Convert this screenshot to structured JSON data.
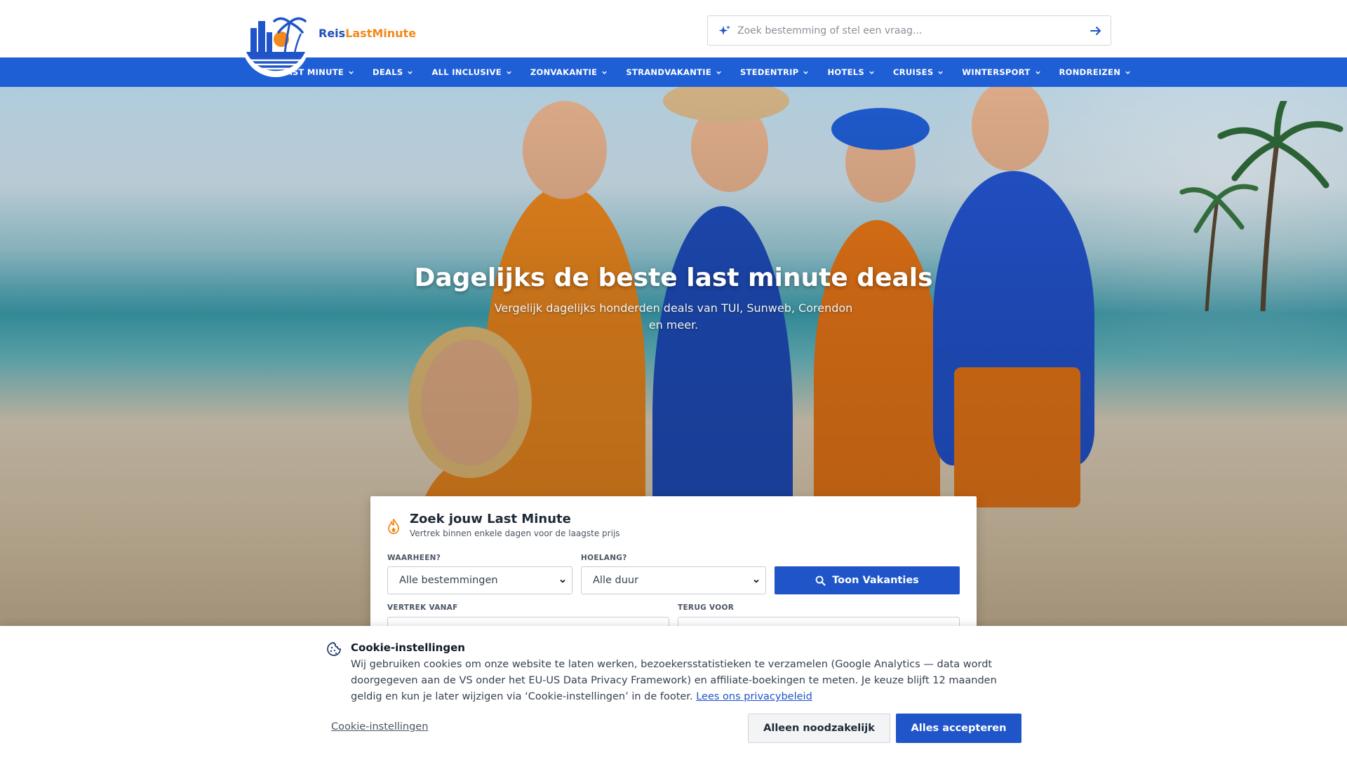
{
  "header": {
    "brand_part1": "Reis",
    "brand_part2": "LastMinute",
    "search_placeholder": "Zoek bestemming of stel een vraag..."
  },
  "nav": {
    "items": [
      {
        "label": "LAST MINUTE"
      },
      {
        "label": "DEALS"
      },
      {
        "label": "ALL INCLUSIVE"
      },
      {
        "label": "ZONVAKANTIE"
      },
      {
        "label": "STRANDVAKANTIE"
      },
      {
        "label": "STEDENTRIP"
      },
      {
        "label": "HOTELS"
      },
      {
        "label": "CRUISES"
      },
      {
        "label": "WINTERSPORT"
      },
      {
        "label": "RONDREIZEN"
      }
    ]
  },
  "hero": {
    "title": "Dagelijks de beste last minute deals",
    "subtitle": "Vergelijk dagelijks honderden deals van TUI, Sunweb, Corendon en meer."
  },
  "search_card": {
    "title": "Zoek jouw Last Minute",
    "subtitle": "Vertrek binnen enkele dagen voor de laagste prijs",
    "destination_label": "WAARHEEN?",
    "destination_value": "Alle bestemmingen",
    "duration_label": "HOELANG?",
    "duration_value": "Alle duur",
    "search_button": "Toon Vakanties",
    "departure_label": "VERTREK VANAF",
    "return_label": "TERUG VOOR"
  },
  "cookie": {
    "title": "Cookie-instellingen",
    "text": "Wij gebruiken cookies om onze website te laten werken, bezoekersstatistieken te verzamelen (Google Analytics — data wordt doorgegeven aan de VS onder het EU-US Data Privacy Framework) en affiliate-boekingen te meten. Je keuze blijft 12 maanden geldig en kun je later wijzigen via ‘Cookie-instellingen’ in de footer.",
    "privacy_link": "Lees ons privacybeleid",
    "settings_link": "Cookie-instellingen",
    "necessary_button": "Alleen noodzakelijk",
    "accept_button": "Alles accepteren"
  },
  "colors": {
    "primary": "#1f5fd6",
    "button_blue": "#1f55c8",
    "accent_orange": "#f2891c"
  }
}
